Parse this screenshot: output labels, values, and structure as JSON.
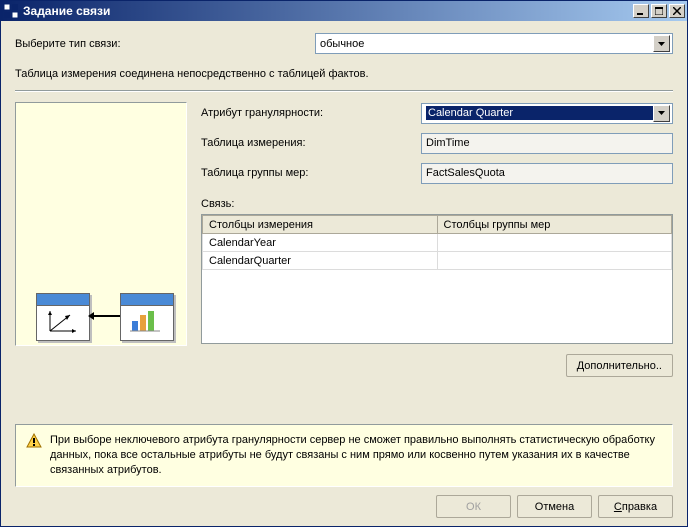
{
  "window": {
    "title": "Задание связи"
  },
  "type_row": {
    "label": "Выберите тип связи:",
    "value": "обычное"
  },
  "hint": "Таблица измерения соединена непосредственно с таблицей фактов.",
  "fields": {
    "granularity_label": "Атрибут гранулярности:",
    "granularity_value": "Calendar Quarter",
    "dim_table_label": "Таблица измерения:",
    "dim_table_value": "DimTime",
    "mg_table_label": "Таблица группы мер:",
    "mg_table_value": "FactSalesQuota"
  },
  "rel": {
    "label": "Связь:",
    "col_dim": "Столбцы измерения",
    "col_mg": "Столбцы группы мер",
    "rows": [
      {
        "dim": "CalendarYear",
        "mg": ""
      },
      {
        "dim": "CalendarQuarter",
        "mg": ""
      }
    ]
  },
  "buttons": {
    "advanced": "Дополнительно..",
    "ok": "ОК",
    "cancel": "Отмена",
    "help": "Справка"
  },
  "warning": "При выборе неключевого атрибута гранулярности сервер не сможет правильно выполнять статистическую обработку данных, пока все остальные атрибуты не будут связаны с ним прямо или косвенно путем указания их в качестве связанных атрибутов."
}
